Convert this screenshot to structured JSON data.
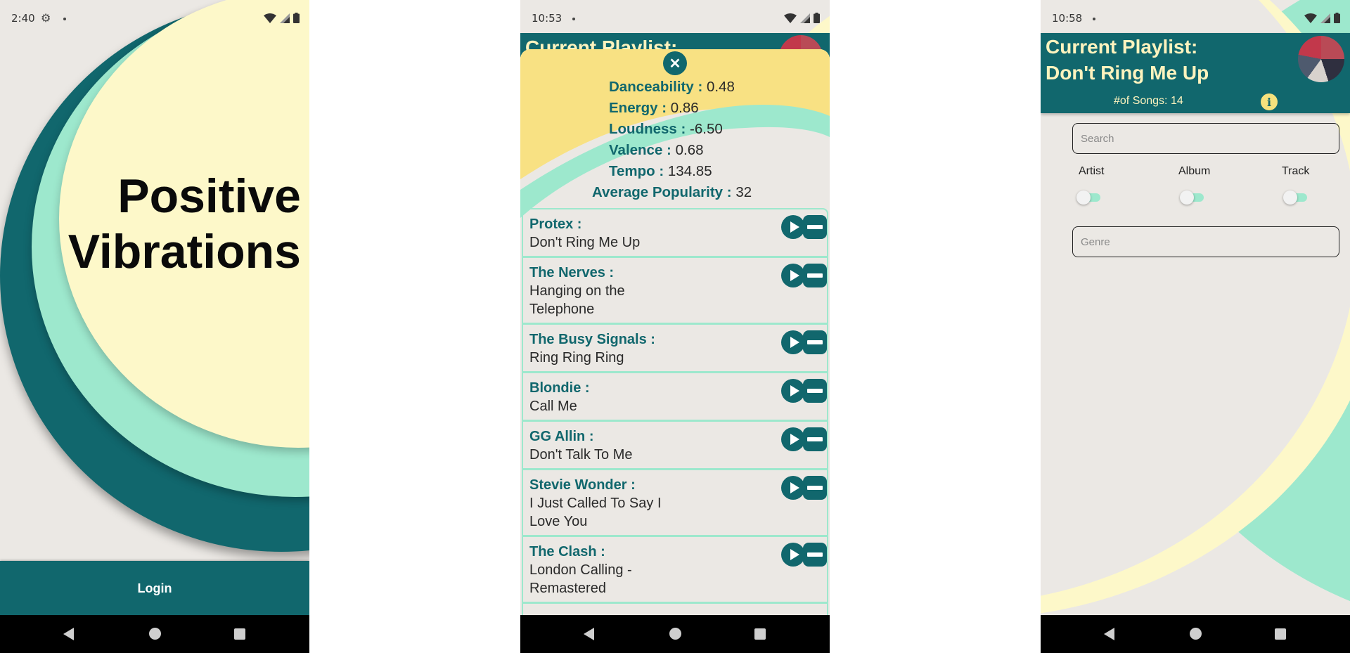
{
  "screens": [
    {
      "status": {
        "time": "2:40"
      },
      "app_title_line1": "Positive",
      "app_title_line2": "Vibrations",
      "login_label": "Login"
    },
    {
      "status": {
        "time": "10:53"
      },
      "header": {
        "title": "Current Playlist:"
      },
      "stats": [
        {
          "label": "Danceability :",
          "value": "0.48"
        },
        {
          "label": "Energy :",
          "value": "0.86"
        },
        {
          "label": "Loudness :",
          "value": "-6.50"
        },
        {
          "label": "Valence :",
          "value": "0.68"
        },
        {
          "label": "Tempo :",
          "value": "134.85"
        },
        {
          "label": "Average Popularity :",
          "value": "32"
        }
      ],
      "songs": [
        {
          "artist": "Protex :",
          "track": "Don't Ring Me Up"
        },
        {
          "artist": "The Nerves :",
          "track": "Hanging on the Telephone"
        },
        {
          "artist": "The Busy Signals :",
          "track": "Ring Ring Ring"
        },
        {
          "artist": "Blondie :",
          "track": "Call Me"
        },
        {
          "artist": "GG Allin :",
          "track": "Don't Talk To Me"
        },
        {
          "artist": "Stevie Wonder :",
          "track": "I Just Called To Say I Love You"
        },
        {
          "artist": "The Clash :",
          "track": "London Calling - Remastered"
        }
      ]
    },
    {
      "status": {
        "time": "10:58"
      },
      "header": {
        "title_line1": "Current Playlist:",
        "title_line2": "Don't Ring Me Up",
        "song_count": "#of Songs: 14"
      },
      "search": {
        "placeholder": "Search"
      },
      "filters": [
        {
          "label": "Artist"
        },
        {
          "label": "Album"
        },
        {
          "label": "Track"
        }
      ],
      "genre": {
        "placeholder": "Genre"
      }
    }
  ],
  "colors": {
    "teal": "#11676d",
    "mint": "#9de8cd",
    "cream": "#fdf8c9",
    "yellow": "#f8e183",
    "background": "#ebe8e4"
  }
}
